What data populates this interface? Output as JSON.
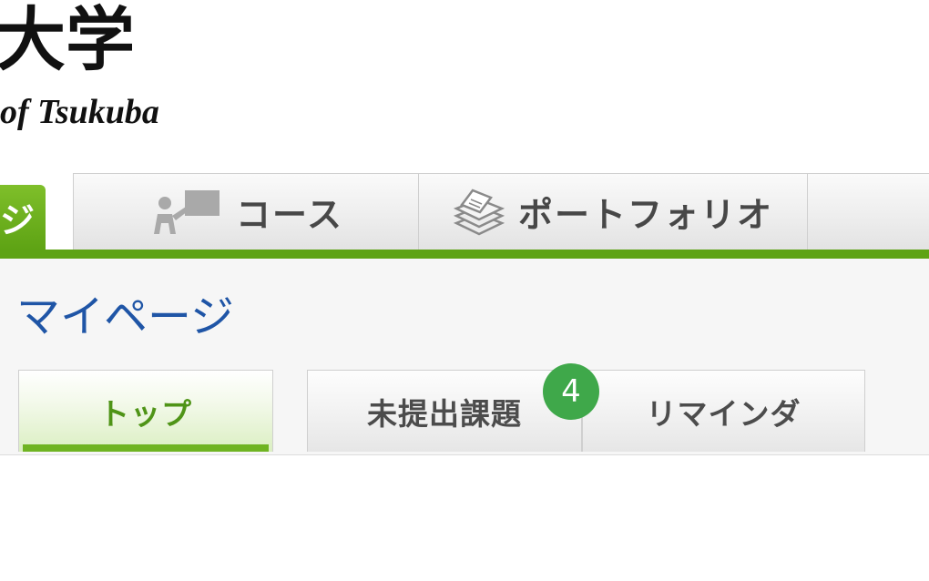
{
  "header": {
    "logo_jp": "大学",
    "logo_en": "of Tsukuba"
  },
  "main_nav": {
    "items": [
      {
        "label": "ジ",
        "icon": "none",
        "active": true
      },
      {
        "label": "コース",
        "icon": "course-icon",
        "active": false
      },
      {
        "label": "ポートフォリオ",
        "icon": "portfolio-icon",
        "active": false
      },
      {
        "label": "",
        "icon": "none",
        "active": false
      }
    ]
  },
  "page": {
    "title": "マイページ"
  },
  "sub_nav": {
    "items": [
      {
        "label": "トップ",
        "active": true
      },
      {
        "label": "未提出課題",
        "badge": "4",
        "active": false
      },
      {
        "label": "リマインダ",
        "active": false
      }
    ]
  },
  "colors": {
    "accent_green": "#5ea314",
    "title_blue": "#1f55a6",
    "badge_green": "#3fa84a"
  }
}
